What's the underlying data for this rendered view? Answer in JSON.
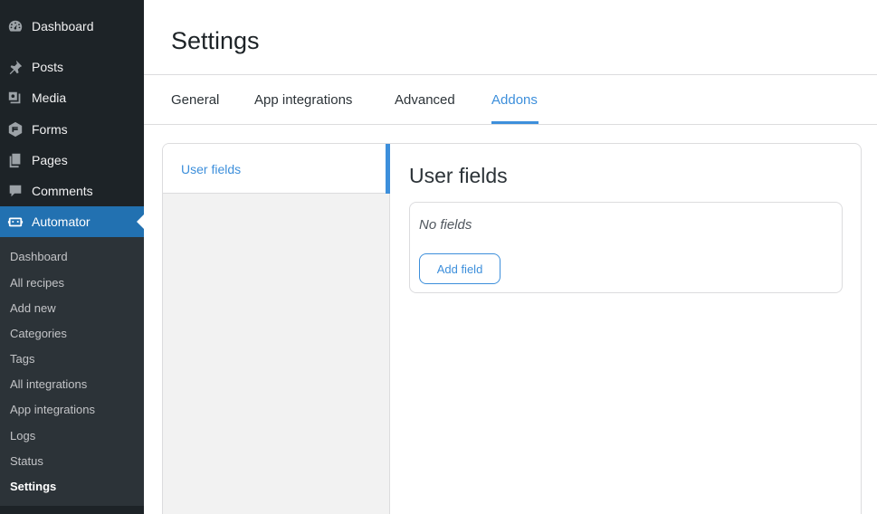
{
  "sidebar": {
    "menu": [
      {
        "label": "Dashboard",
        "icon": "dashboard-icon"
      },
      {
        "label": "Posts",
        "icon": "pin-icon"
      },
      {
        "label": "Media",
        "icon": "media-icon"
      },
      {
        "label": "Forms",
        "icon": "forms-icon"
      },
      {
        "label": "Pages",
        "icon": "pages-icon"
      },
      {
        "label": "Comments",
        "icon": "comment-icon"
      },
      {
        "label": "Automator",
        "icon": "robot-icon",
        "active": true
      }
    ],
    "submenu": [
      {
        "label": "Dashboard"
      },
      {
        "label": "All recipes"
      },
      {
        "label": "Add new"
      },
      {
        "label": "Categories"
      },
      {
        "label": "Tags"
      },
      {
        "label": "All integrations"
      },
      {
        "label": "App integrations"
      },
      {
        "label": "Logs"
      },
      {
        "label": "Status"
      },
      {
        "label": "Settings",
        "current": true
      }
    ]
  },
  "header": {
    "title": "Settings"
  },
  "tabs": [
    {
      "label": "General"
    },
    {
      "label": "App integrations"
    },
    {
      "label": "Advanced"
    },
    {
      "label": "Addons",
      "active": true
    }
  ],
  "left_panel": {
    "items": [
      {
        "label": "User fields",
        "active": true
      }
    ]
  },
  "main": {
    "section_title": "User fields",
    "empty_text": "No fields",
    "add_button_label": "Add field"
  },
  "colors": {
    "sidebar_bg": "#1d2327",
    "submenu_bg": "#2c3338",
    "menu_active_bg": "#2271b1",
    "accent": "#3d8fdb"
  }
}
